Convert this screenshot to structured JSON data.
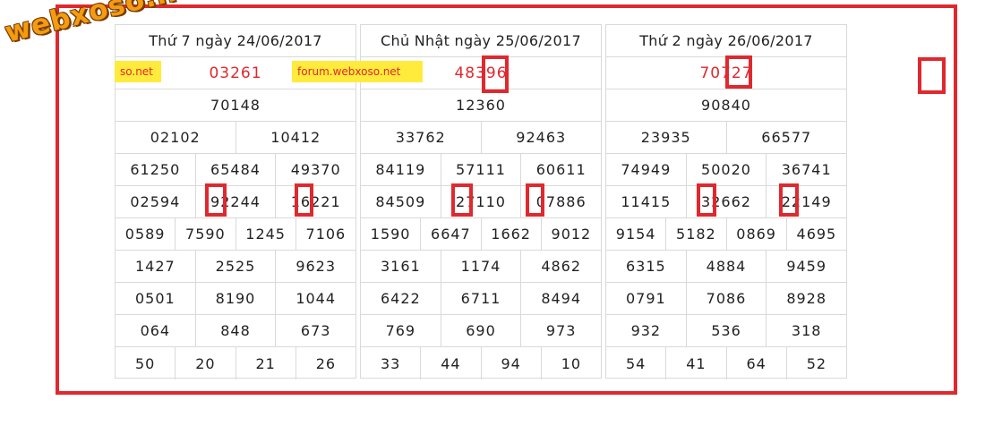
{
  "watermark": {
    "logo_text": "webxoso.net",
    "banner_left": "so.net",
    "banner_mid": "forum.webxoso.net"
  },
  "accent_color": "#e0282e",
  "tables": [
    {
      "title": "Thứ 7 ngày 24/06/2017",
      "rows": [
        [
          "03261"
        ],
        [
          "70148"
        ],
        [
          "02102",
          "10412"
        ],
        [
          "61250",
          "65484",
          "49370"
        ],
        [
          "02594",
          "92244",
          "16221"
        ],
        [
          "0589",
          "7590",
          "1245",
          "7106"
        ],
        [
          "1427",
          "2525",
          "9623"
        ],
        [
          "0501",
          "8190",
          "1044"
        ],
        [
          "064",
          "848",
          "673"
        ],
        [
          "50",
          "20",
          "21",
          "26"
        ]
      ]
    },
    {
      "title": "Chủ Nhật ngày 25/06/2017",
      "rows": [
        [
          "48396"
        ],
        [
          "12360"
        ],
        [
          "33762",
          "92463"
        ],
        [
          "84119",
          "57111",
          "60611"
        ],
        [
          "84509",
          "27110",
          "07886"
        ],
        [
          "1590",
          "6647",
          "1662",
          "9012"
        ],
        [
          "3161",
          "1174",
          "4862"
        ],
        [
          "6422",
          "6711",
          "8494"
        ],
        [
          "769",
          "690",
          "973"
        ],
        [
          "33",
          "44",
          "94",
          "10"
        ]
      ]
    },
    {
      "title": "Thứ 2 ngày 26/06/2017",
      "rows": [
        [
          "70727"
        ],
        [
          "90840"
        ],
        [
          "23935",
          "66577"
        ],
        [
          "74949",
          "50020",
          "36741"
        ],
        [
          "11415",
          "32662",
          "22149"
        ],
        [
          "9154",
          "5182",
          "0869",
          "4695"
        ],
        [
          "6315",
          "4884",
          "9459"
        ],
        [
          "0791",
          "7086",
          "8928"
        ],
        [
          "932",
          "536",
          "318"
        ],
        [
          "54",
          "41",
          "64",
          "52"
        ]
      ]
    }
  ]
}
